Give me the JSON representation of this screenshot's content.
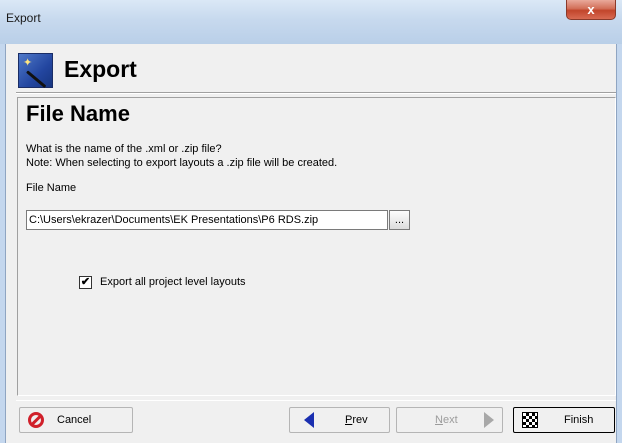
{
  "window": {
    "title": "Export",
    "close_glyph": "x"
  },
  "header": {
    "title": "Export",
    "icon": "wizard-wand-icon"
  },
  "page": {
    "title": "File Name",
    "description_line1": "What is the name of the .xml or .zip file?",
    "description_line2": "Note: When selecting to export layouts a .zip file will be created.",
    "field_label": "File Name",
    "file_name_value": "C:\\Users\\ekrazer\\Documents\\EK Presentations\\P6 RDS.zip",
    "browse_label": "...",
    "export_layouts": {
      "label": "Export all project level layouts",
      "checked": true,
      "check_glyph": "✔"
    }
  },
  "footer": {
    "cancel": {
      "label": "Cancel",
      "icon": "cancel-icon"
    },
    "prev": {
      "label_first": "P",
      "label_rest": "rev",
      "icon": "arrow-left-icon"
    },
    "next": {
      "label_first": "N",
      "label_rest": "ext",
      "icon": "arrow-right-icon",
      "enabled": false
    },
    "finish": {
      "label": "Finish",
      "icon": "checkered-flag-icon"
    }
  },
  "colors": {
    "accent": "#1a2fb0",
    "cancel_red": "#d0202a",
    "disabled_gray": "#9c9c9c"
  }
}
